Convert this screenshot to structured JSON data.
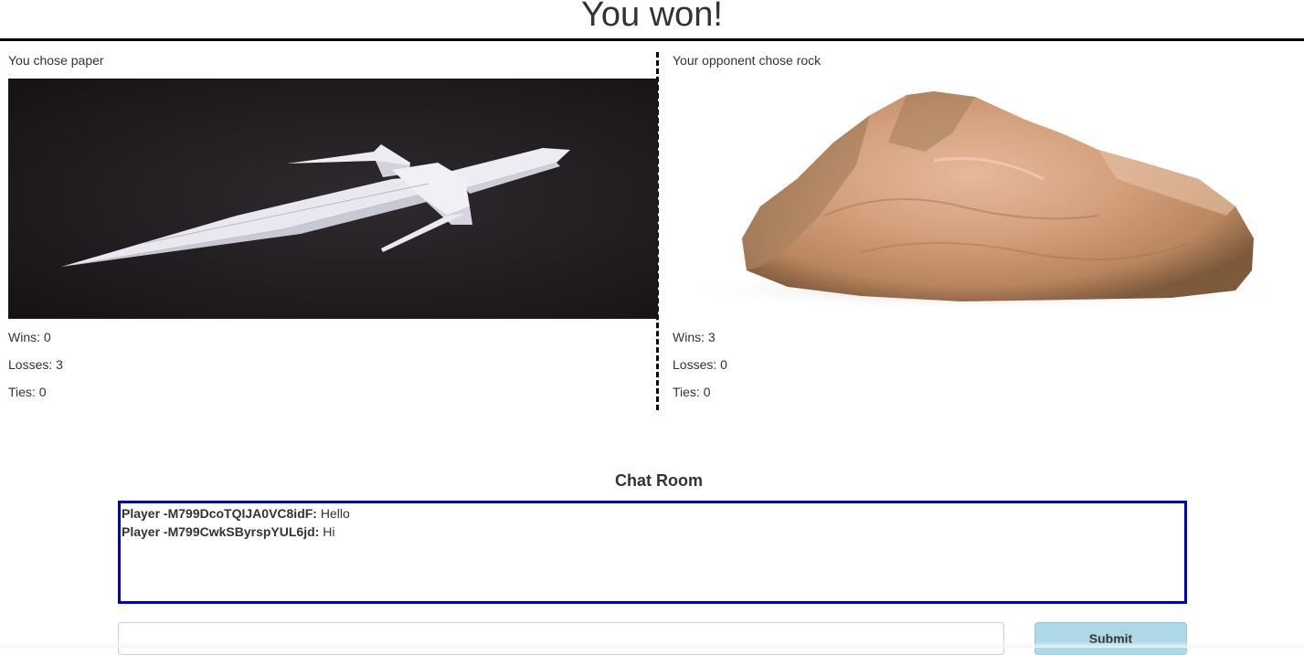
{
  "header": {
    "result_title": "You won!"
  },
  "player": {
    "choice_text": "You chose paper",
    "choice": "paper",
    "image_icon": "paper-origami-sword-image",
    "wins_text": "Wins: 0",
    "losses_text": "Losses: 3",
    "ties_text": "Ties: 0"
  },
  "opponent": {
    "choice_text": "Your opponent chose rock",
    "choice": "rock",
    "image_icon": "rock-image",
    "wins_text": "Wins: 3",
    "losses_text": "Losses: 0",
    "ties_text": "Ties: 0"
  },
  "chat": {
    "title": "Chat Room",
    "messages": [
      {
        "sender": "Player -M799DcoTQIJA0VC8idF:",
        "text": " Hello"
      },
      {
        "sender": "Player -M799CwkSByrspYUL6jd:",
        "text": " Hi"
      }
    ],
    "input_value": "",
    "input_placeholder": "",
    "submit_label": "Submit"
  },
  "colors": {
    "chat_border": "#0000cc",
    "submit_bg": "#add8e6",
    "title_rule": "#000000"
  }
}
